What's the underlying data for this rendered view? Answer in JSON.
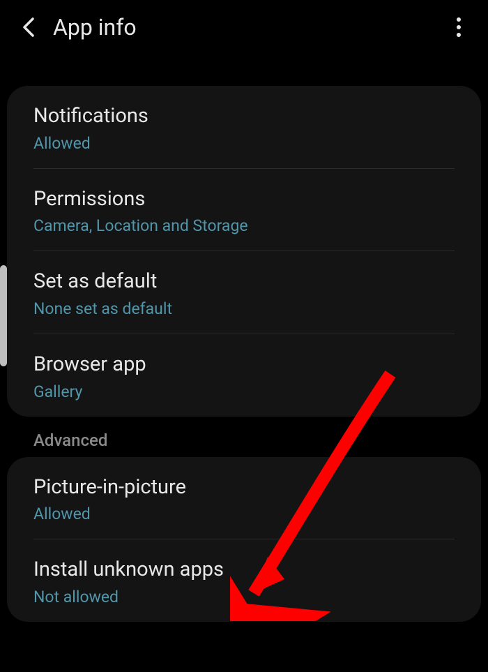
{
  "header": {
    "title": "App info"
  },
  "settings": {
    "items": [
      {
        "label": "Notifications",
        "sub": "Allowed"
      },
      {
        "label": "Permissions",
        "sub": "Camera, Location and Storage"
      },
      {
        "label": "Set as default",
        "sub": "None set as default"
      },
      {
        "label": "Browser app",
        "sub": "Gallery"
      }
    ]
  },
  "advanced": {
    "header": "Advanced",
    "items": [
      {
        "label": "Picture-in-picture",
        "sub": "Allowed"
      },
      {
        "label": "Install unknown apps",
        "sub": "Not allowed"
      }
    ]
  }
}
